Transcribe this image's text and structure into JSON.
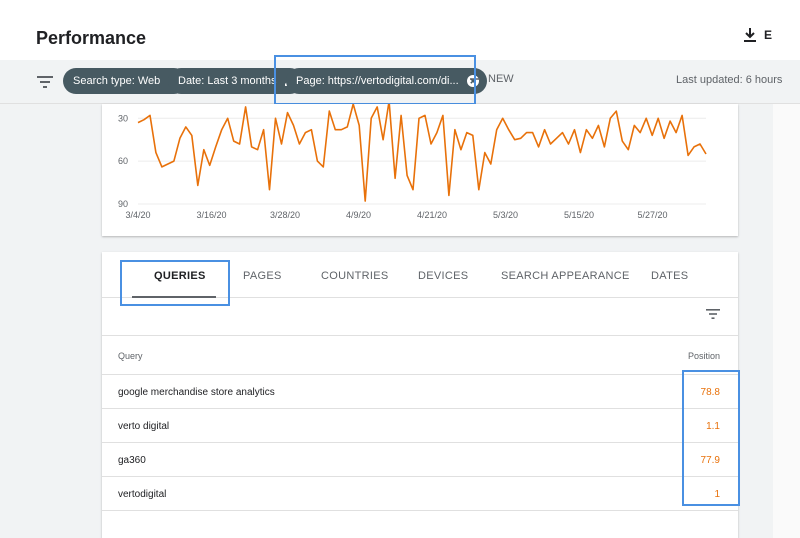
{
  "header": {
    "title": "Performance",
    "export_label": "E"
  },
  "filters": {
    "chips": [
      {
        "label": "Search type: Web"
      },
      {
        "label": "Date: Last 3 months"
      },
      {
        "label": "Page: https://vertodigital.com/di..."
      }
    ],
    "new_label": "NEW",
    "last_updated": "Last updated: 6 hours"
  },
  "chart_data": {
    "type": "line",
    "y_reversed": true,
    "ylim": [
      90,
      20
    ],
    "y_ticks": [
      "30",
      "60",
      "90"
    ],
    "x_ticks": [
      "3/4/20",
      "3/16/20",
      "3/28/20",
      "4/9/20",
      "4/21/20",
      "5/3/20",
      "5/15/20",
      "5/27/20"
    ],
    "grid": true,
    "color": "#e8710a",
    "series": [
      {
        "values": [
          33,
          31,
          28,
          54,
          64,
          62,
          60,
          44,
          36,
          42,
          77,
          52,
          63,
          50,
          38,
          30,
          46,
          48,
          22,
          50,
          52,
          38,
          80,
          30,
          48,
          26,
          35,
          48,
          40,
          38,
          60,
          64,
          25,
          38,
          38,
          36,
          20,
          35,
          88,
          30,
          22,
          45,
          18,
          72,
          28,
          70,
          80,
          30,
          28,
          48,
          40,
          28,
          84,
          38,
          52,
          40,
          42,
          80,
          54,
          62,
          38,
          30,
          38,
          45,
          44,
          40,
          40,
          50,
          38,
          48,
          44,
          40,
          48,
          38,
          54,
          38,
          44,
          35,
          50,
          30,
          25,
          46,
          52,
          35,
          40,
          30,
          42,
          30,
          44,
          32,
          40,
          28,
          56,
          50,
          48,
          55
        ]
      }
    ]
  },
  "tabs": [
    "QUERIES",
    "PAGES",
    "COUNTRIES",
    "DEVICES",
    "SEARCH APPEARANCE",
    "DATES"
  ],
  "table": {
    "headers": {
      "query": "Query",
      "position": "Position"
    },
    "rows": [
      {
        "query": "google merchandise store analytics",
        "position": "78.8"
      },
      {
        "query": "verto digital",
        "position": "1.1"
      },
      {
        "query": "ga360",
        "position": "77.9"
      },
      {
        "query": "vertodigital",
        "position": "1"
      }
    ]
  }
}
